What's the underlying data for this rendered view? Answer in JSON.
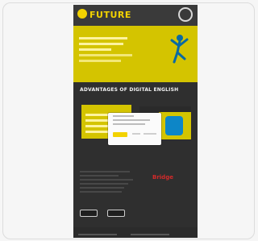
{
  "app": {
    "logo_text": "FUTURE",
    "brand_text": "Bridge"
  },
  "colors": {
    "accent_yellow": "#d4c400",
    "dark_bg": "#2f2f2f",
    "modal_bg": "#fbfbfb",
    "brand_red": "#d22a2a"
  },
  "sections": {
    "title": "ADVANTAGES OF DIGITAL ENGLISH"
  }
}
